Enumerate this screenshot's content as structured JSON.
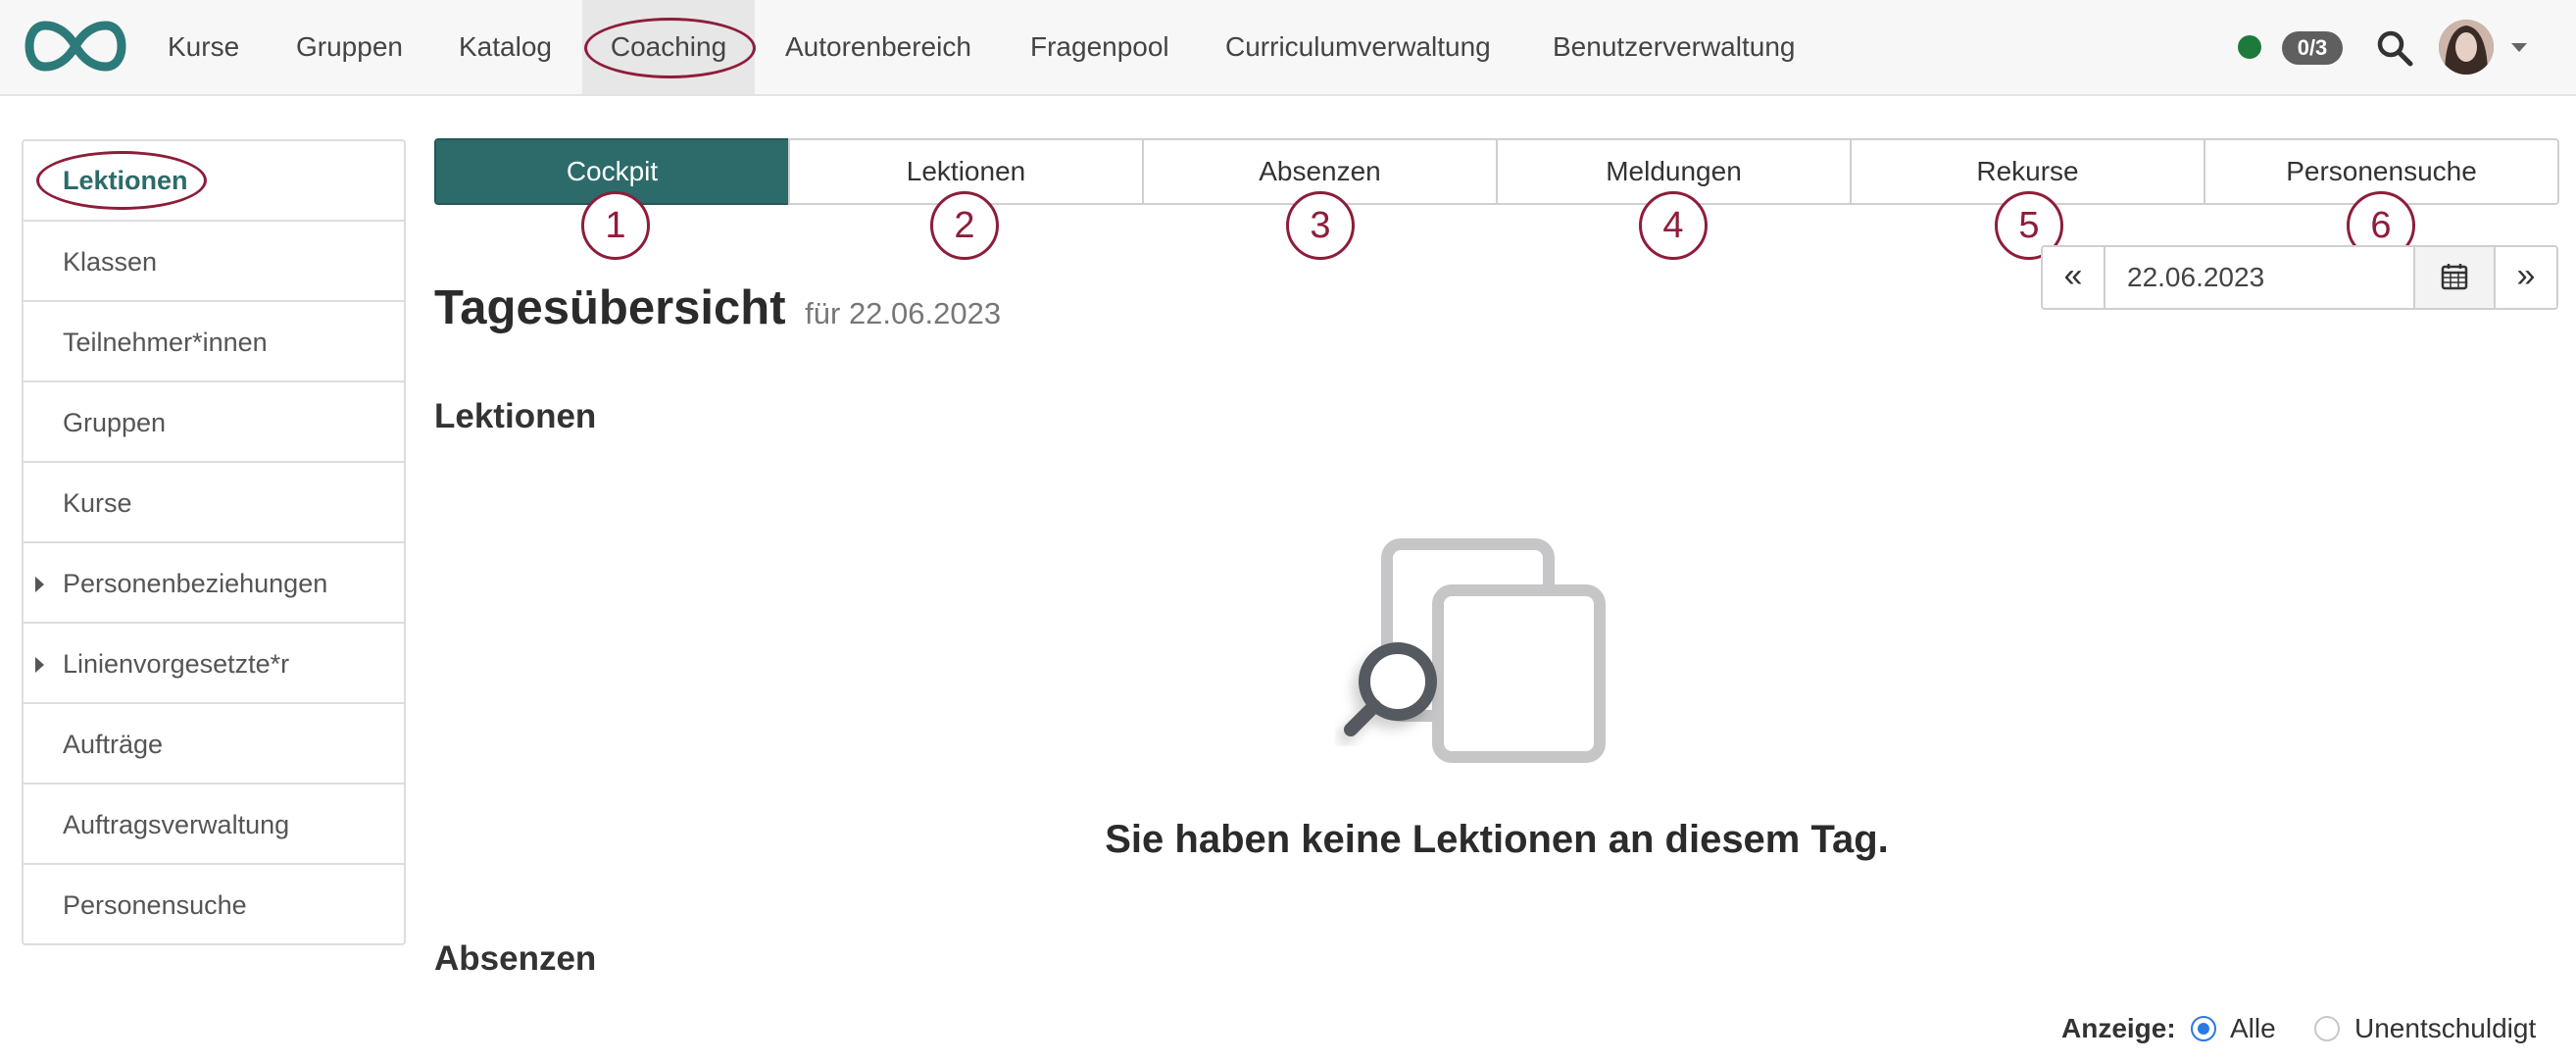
{
  "topnav": {
    "items": [
      {
        "label": "Kurse"
      },
      {
        "label": "Gruppen"
      },
      {
        "label": "Katalog"
      },
      {
        "label": "Coaching",
        "active": true
      },
      {
        "label": "Autorenbereich"
      },
      {
        "label": "Fragenpool"
      },
      {
        "label": "Curriculumverwaltung"
      },
      {
        "label": "Benutzerverwaltung"
      }
    ],
    "badge": "0/3",
    "status_color": "#1e7a3a"
  },
  "sidebar": {
    "items": [
      {
        "label": "Lektionen",
        "active": true
      },
      {
        "label": "Klassen"
      },
      {
        "label": "Teilnehmer*innen"
      },
      {
        "label": "Gruppen"
      },
      {
        "label": "Kurse"
      },
      {
        "label": "Personenbeziehungen",
        "expandable": true
      },
      {
        "label": "Linienvorgesetzte*r",
        "expandable": true
      },
      {
        "label": "Aufträge"
      },
      {
        "label": "Auftragsverwaltung"
      },
      {
        "label": "Personensuche"
      }
    ]
  },
  "tabs": [
    {
      "label": "Cockpit",
      "active": true,
      "marker": "1"
    },
    {
      "label": "Lektionen",
      "marker": "2"
    },
    {
      "label": "Absenzen",
      "marker": "3"
    },
    {
      "label": "Meldungen",
      "marker": "4"
    },
    {
      "label": "Rekurse",
      "marker": "5"
    },
    {
      "label": "Personensuche",
      "marker": "6"
    }
  ],
  "page": {
    "title": "Tagesübersicht",
    "subtitle": "für 22.06.2023",
    "date_value": "22.06.2023",
    "prev_label": "«",
    "next_label": "»"
  },
  "lektionen": {
    "heading": "Lektionen",
    "empty_message": "Sie haben keine Lektionen an diesem Tag."
  },
  "absenzen": {
    "heading": "Absenzen",
    "filter_label": "Anzeige:",
    "options": [
      {
        "label": "Alle",
        "checked": true
      },
      {
        "label": "Unentschuldigt",
        "checked": false
      }
    ]
  },
  "colors": {
    "accent": "#2d6b6b",
    "annotation": "#8e1d3a",
    "radio_selected": "#2a7ae2"
  }
}
